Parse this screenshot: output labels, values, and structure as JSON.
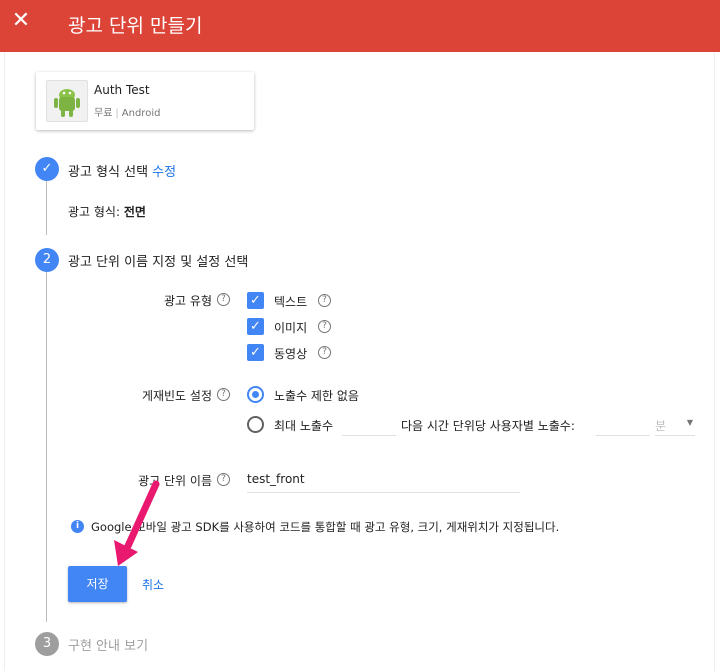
{
  "header": {
    "title": "광고 단위 만들기",
    "close_glyph": "✕"
  },
  "app": {
    "name": "Auth Test",
    "platform_owner": "무료",
    "platform": "Android"
  },
  "step1": {
    "number": "✓",
    "title": "광고 형식 선택",
    "edit_link": "수정",
    "format_label": "광고 형식:",
    "format_value": "전면"
  },
  "step2": {
    "number": "2",
    "title": "광고 단위 이름 지정 및 설정 선택",
    "ad_type": {
      "label": "광고 유형",
      "options": [
        "텍스트",
        "이미지",
        "동영상"
      ]
    },
    "frequency": {
      "label": "게재빈도 설정",
      "option_unlimited": "노출수 제한 없음",
      "option_max": "최대 노출수",
      "per_text": "다음 시간 단위당 사용자별 노출수:",
      "unit_placeholder": "분"
    },
    "ad_unit_name": {
      "label": "광고 단위 이름",
      "value": "test_front"
    },
    "info": "Google 모바일 광고 SDK를 사용하여 코드를 통합할 때 광고 유형, 크기, 게재위치가 지정됩니다.",
    "save_label": "저장",
    "cancel_label": "취소"
  },
  "step3": {
    "number": "3",
    "title": "구현 안내 보기"
  },
  "colors": {
    "header": "#db4437",
    "primary": "#4285f4",
    "arrow": "#e8196e"
  }
}
